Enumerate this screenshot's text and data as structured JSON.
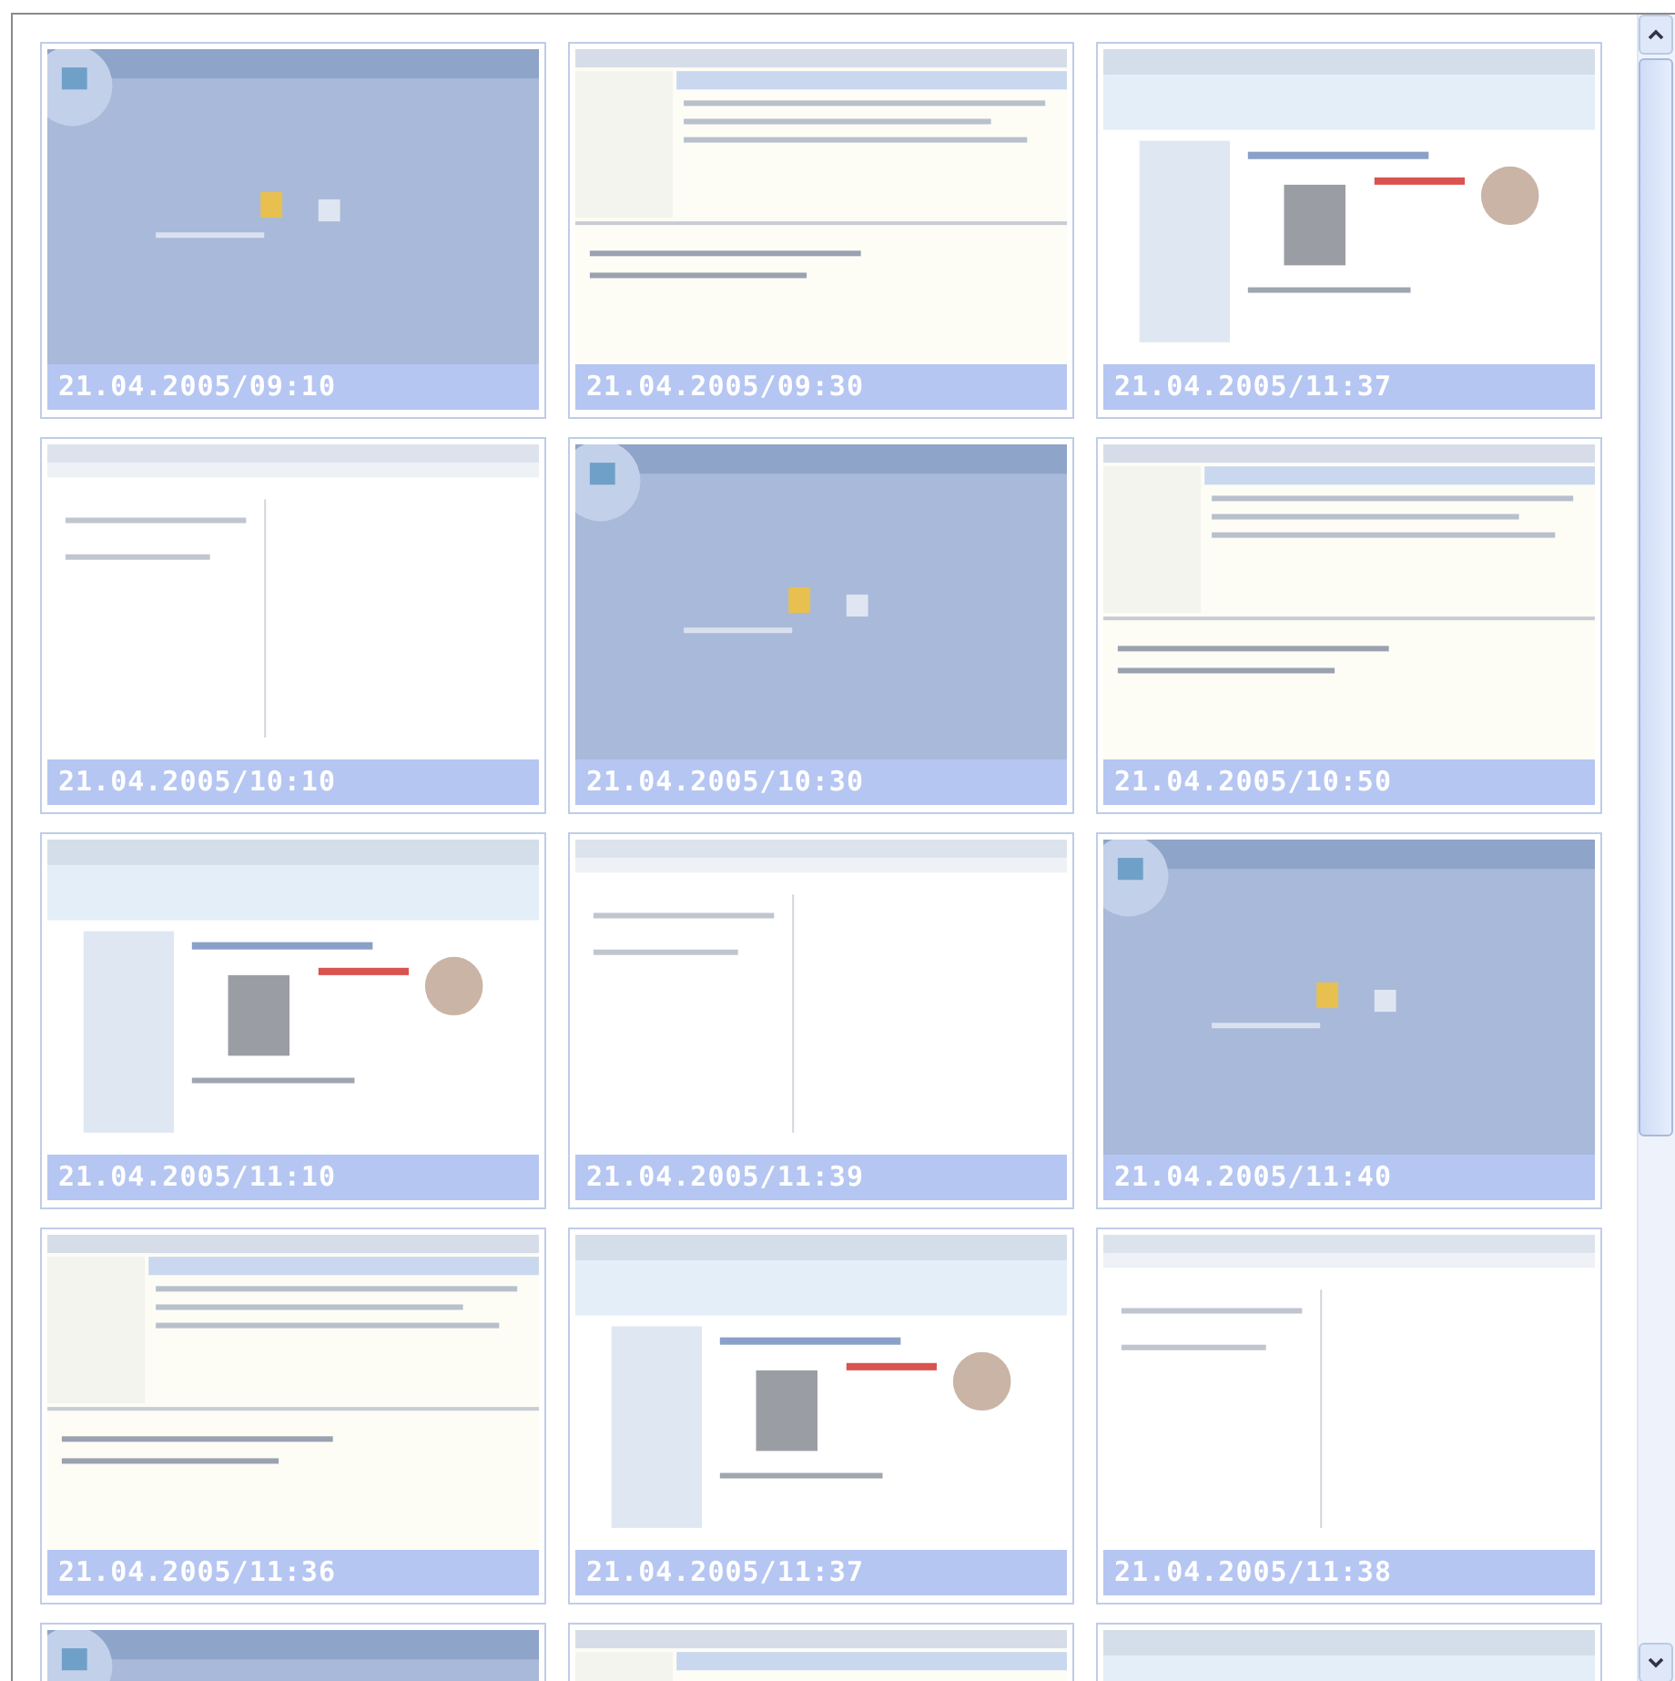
{
  "thumbnails": [
    {
      "kind": "picture",
      "caption": "21.04.2005/09:10"
    },
    {
      "kind": "picture",
      "caption": "21.04.2005/09:30"
    },
    {
      "kind": "picture",
      "caption": "21.04.2005/11:37"
    },
    {
      "kind": "picture",
      "caption": "21.04.2005/10:10"
    },
    {
      "kind": "picture",
      "caption": "21.04.2005/10:30"
    },
    {
      "kind": "picture",
      "caption": "21.04.2005/10:50"
    },
    {
      "kind": "picture",
      "caption": "21.04.2005/11:10"
    },
    {
      "kind": "picture",
      "caption": "21.04.2005/11:39"
    },
    {
      "kind": "picture",
      "caption": "21.04.2005/11:40"
    },
    {
      "kind": "picture",
      "caption": "21.04.2005/11:36"
    },
    {
      "kind": "picture",
      "caption": "21.04.2005/11:37"
    },
    {
      "kind": "picture",
      "caption": "21.04.2005/11:38"
    },
    {
      "kind": "picture"
    },
    {
      "kind": "picture"
    },
    {
      "kind": "picture"
    }
  ]
}
